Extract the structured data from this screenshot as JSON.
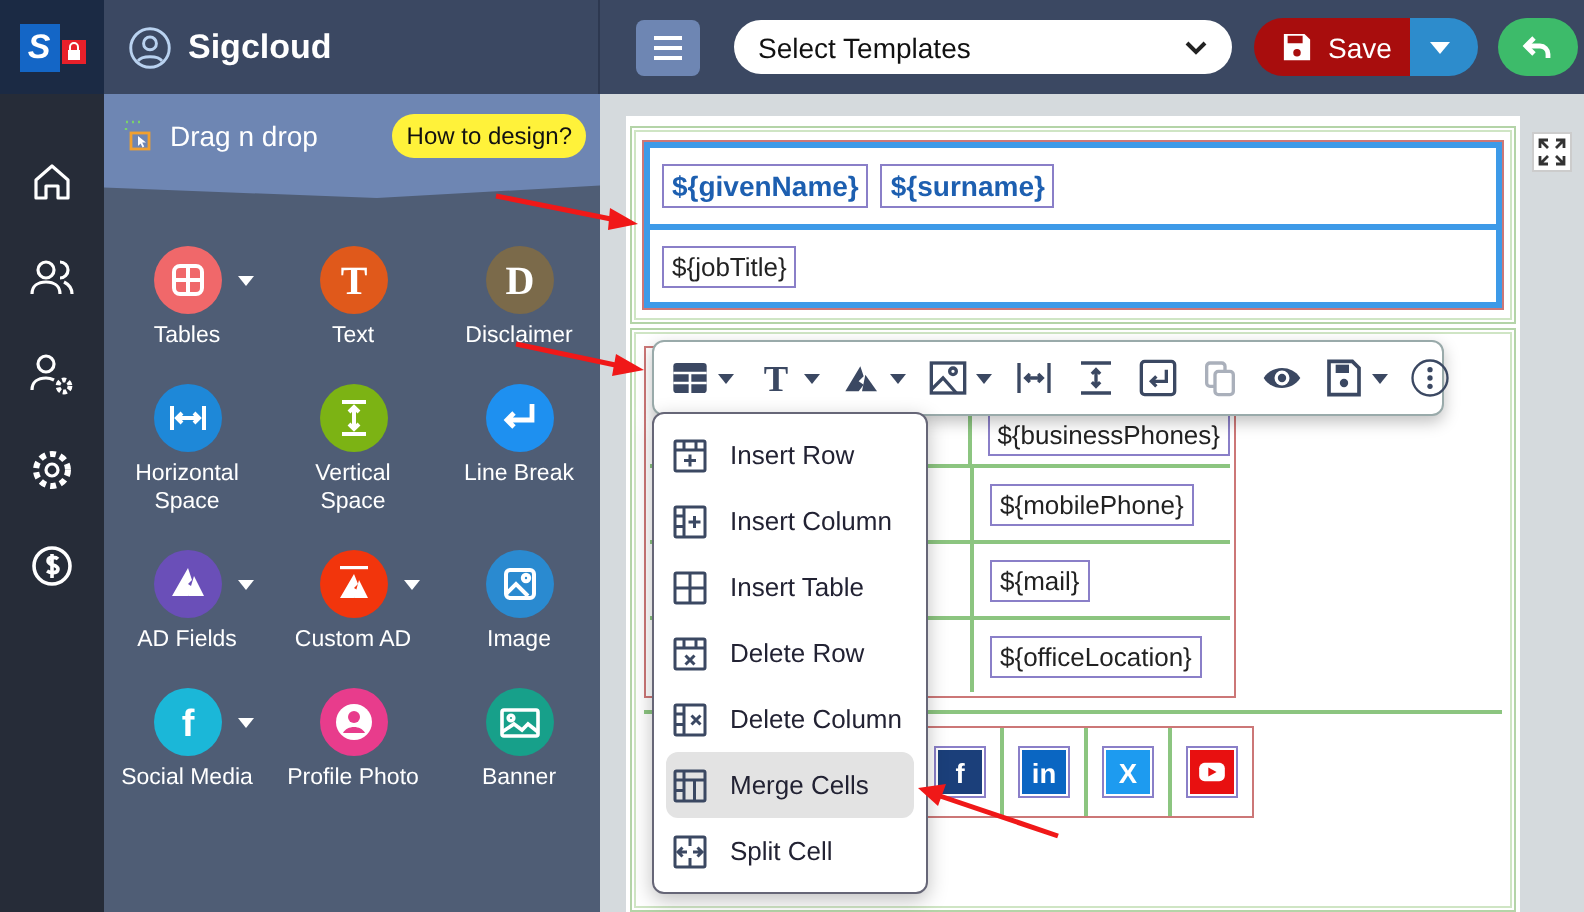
{
  "app": {
    "logo_text": "S",
    "name": "Sigcloud"
  },
  "header": {
    "template_select": {
      "placeholder": "Select Templates"
    },
    "save_button": "Save"
  },
  "sidebar": {
    "title": "Drag n drop",
    "help_button": "How to design?",
    "tools": [
      {
        "label": "Tables",
        "kind": "tables",
        "color": "#f0686a",
        "dropdown": true
      },
      {
        "label": "Text",
        "kind": "letter",
        "glyph": "T",
        "color": "#e0591b",
        "dropdown": false
      },
      {
        "label": "Disclaimer",
        "kind": "letter",
        "glyph": "D",
        "color": "#7b6a4a",
        "dropdown": false
      },
      {
        "label": "Horizontal Space",
        "kind": "hspace",
        "color": "#1e88d8",
        "dropdown": false
      },
      {
        "label": "Vertical Space",
        "kind": "vspace",
        "color": "#7cb314",
        "dropdown": false
      },
      {
        "label": "Line Break",
        "kind": "linebreak",
        "color": "#1e90f0",
        "dropdown": false
      },
      {
        "label": "AD Fields",
        "kind": "ad",
        "color": "#6a4fb8",
        "dropdown": true
      },
      {
        "label": "Custom AD",
        "kind": "customad",
        "color": "#f2350c",
        "dropdown": true
      },
      {
        "label": "Image",
        "kind": "image",
        "color": "#2a8ad0",
        "dropdown": false
      },
      {
        "label": "Social Media",
        "kind": "social",
        "glyph": "f",
        "color": "#1bb7d8",
        "dropdown": true
      },
      {
        "label": "Profile Photo",
        "kind": "profile",
        "color": "#e83c8c",
        "dropdown": false
      },
      {
        "label": "Banner",
        "kind": "banner",
        "color": "#17a08a",
        "dropdown": false
      }
    ]
  },
  "editor": {
    "header_rows": [
      {
        "bold": true,
        "fields": [
          "${givenName}",
          "${surname}"
        ]
      },
      {
        "bold": false,
        "fields": [
          "${jobTitle}"
        ]
      }
    ],
    "contact_fields": [
      "${businessPhones}",
      "${mobilePhone}",
      "${mail}",
      "${officeLocation}"
    ],
    "social_icons": [
      {
        "kind": "facebook",
        "glyph": "f",
        "color": "#1b3f7a"
      },
      {
        "kind": "linkedin",
        "glyph": "in",
        "color": "#0a66c2"
      },
      {
        "kind": "x",
        "glyph": "X",
        "color": "#1d9bf0"
      },
      {
        "kind": "youtube",
        "color": "#e81010"
      }
    ]
  },
  "format_toolbar": {
    "tools": [
      {
        "kind": "table",
        "dropdown": true,
        "disabled": false
      },
      {
        "kind": "letter",
        "glyph": "T",
        "dropdown": true,
        "disabled": false
      },
      {
        "kind": "ad",
        "dropdown": true,
        "disabled": false
      },
      {
        "kind": "image",
        "dropdown": true,
        "disabled": false
      },
      {
        "kind": "hspace",
        "dropdown": false,
        "disabled": false
      },
      {
        "kind": "vspace",
        "dropdown": false,
        "disabled": false
      },
      {
        "kind": "linebreak",
        "dropdown": false,
        "disabled": false
      },
      {
        "kind": "paste",
        "dropdown": false,
        "disabled": true
      },
      {
        "kind": "preview",
        "dropdown": false,
        "disabled": false
      },
      {
        "kind": "save",
        "dropdown": true,
        "disabled": false
      },
      {
        "kind": "more",
        "dropdown": false,
        "disabled": false
      }
    ]
  },
  "table_menu": {
    "items": [
      {
        "label": "Insert Row",
        "kind": "insert-row",
        "selected": false
      },
      {
        "label": "Insert Column",
        "kind": "insert-column",
        "selected": false
      },
      {
        "label": "Insert Table",
        "kind": "insert-table",
        "selected": false
      },
      {
        "label": "Delete Row",
        "kind": "delete-row",
        "selected": false
      },
      {
        "label": "Delete Column",
        "kind": "delete-column",
        "selected": false
      },
      {
        "label": "Merge Cells",
        "kind": "merge",
        "selected": true
      },
      {
        "label": "Split Cell",
        "kind": "split",
        "selected": false
      }
    ]
  }
}
